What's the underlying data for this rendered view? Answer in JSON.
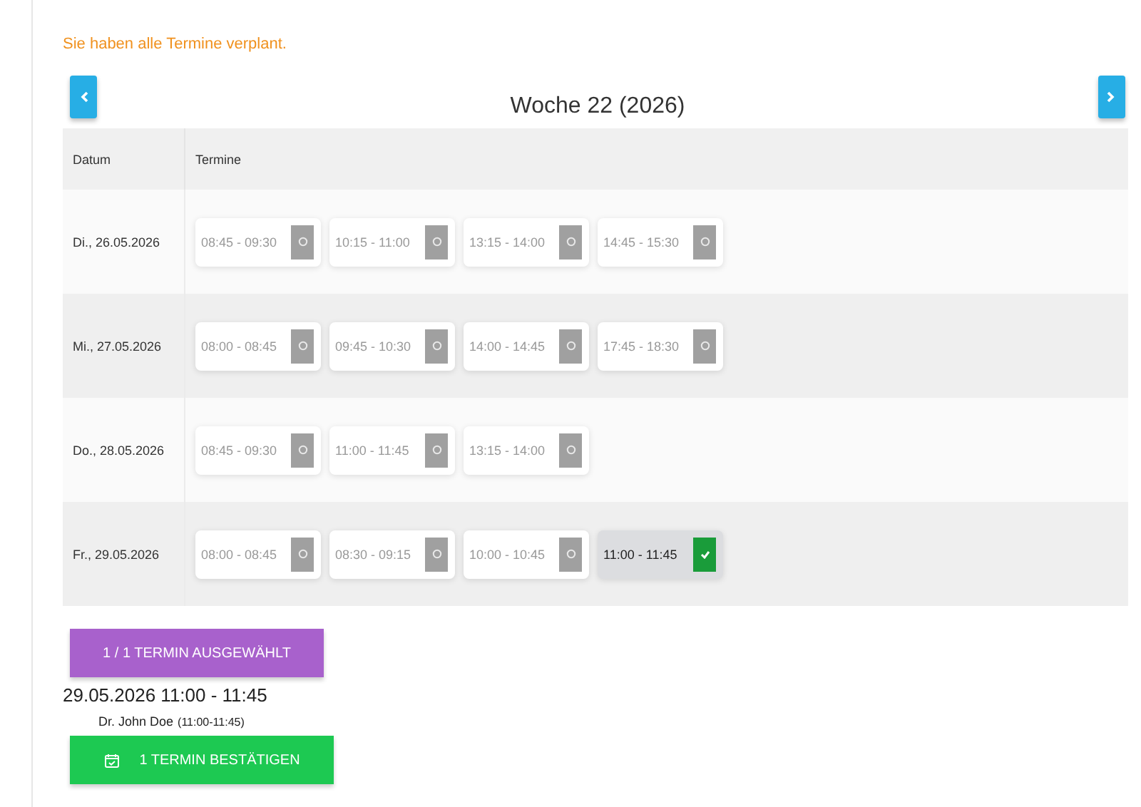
{
  "message": "Sie haben alle Termine verplant.",
  "week_title": "Woche 22 (2026)",
  "table": {
    "columns": [
      "Datum",
      "Termine"
    ],
    "rows": [
      {
        "date": "Di., 26.05.2026",
        "slots": [
          {
            "time": "08:45 - 09:30",
            "selected": false
          },
          {
            "time": "10:15 - 11:00",
            "selected": false
          },
          {
            "time": "13:15 - 14:00",
            "selected": false
          },
          {
            "time": "14:45 - 15:30",
            "selected": false
          }
        ]
      },
      {
        "date": "Mi., 27.05.2026",
        "slots": [
          {
            "time": "08:00 - 08:45",
            "selected": false
          },
          {
            "time": "09:45 - 10:30",
            "selected": false
          },
          {
            "time": "14:00 - 14:45",
            "selected": false
          },
          {
            "time": "17:45 - 18:30",
            "selected": false
          }
        ]
      },
      {
        "date": "Do., 28.05.2026",
        "slots": [
          {
            "time": "08:45 - 09:30",
            "selected": false
          },
          {
            "time": "11:00 - 11:45",
            "selected": false
          },
          {
            "time": "13:15 - 14:00",
            "selected": false
          }
        ]
      },
      {
        "date": "Fr., 29.05.2026",
        "slots": [
          {
            "time": "08:00 - 08:45",
            "selected": false
          },
          {
            "time": "08:30 - 09:15",
            "selected": false
          },
          {
            "time": "10:00 - 10:45",
            "selected": false
          },
          {
            "time": "11:00 - 11:45",
            "selected": true
          }
        ]
      }
    ]
  },
  "selection_button": "1 / 1 TERMIN AUSGEWÄHLT",
  "selected_appointment": "29.05.2026 11:00 - 11:45",
  "doctor": {
    "name": "Dr. John Doe",
    "time": "(11:00-11:45)"
  },
  "confirm_button": "1 TERMIN BESTÄTIGEN"
}
